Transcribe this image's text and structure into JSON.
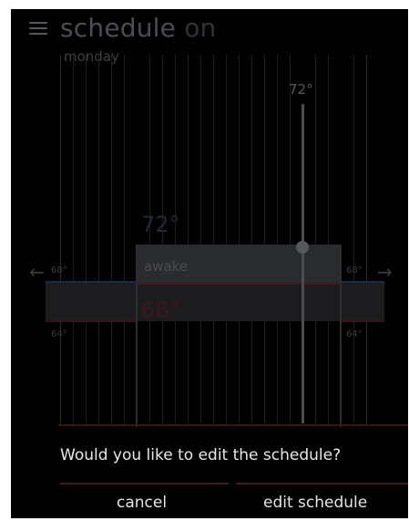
{
  "header": {
    "title": "schedule",
    "title_state": "on",
    "day": "monday"
  },
  "chart": {
    "current_temp_label": "72°",
    "period_name": "awake",
    "heat_setpoint": "72°",
    "cool_setpoint": "68°",
    "left_heat": "68°",
    "left_cool": "64°",
    "right_heat": "68°",
    "right_cool": "64°",
    "prev_icon": "arrow-left-icon",
    "next_icon": "arrow-right-icon"
  },
  "dialog": {
    "question": "Would you like to edit the schedule?",
    "cancel_label": "cancel",
    "edit_label": "edit schedule"
  },
  "colors": {
    "background": "#000000",
    "heat": "#1c2a44",
    "cool": "#3a1518",
    "text": "#e8e8e8"
  }
}
